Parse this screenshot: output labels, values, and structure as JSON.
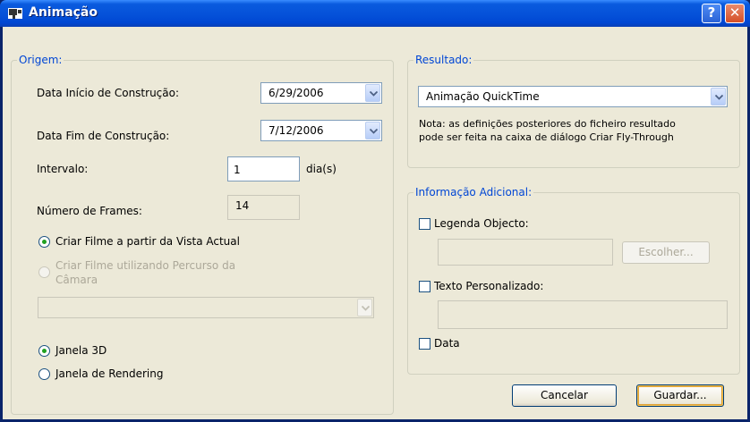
{
  "window": {
    "title": "Animação",
    "help_label": "?",
    "close_label": "✕"
  },
  "origem": {
    "legend": "Origem:",
    "data_inicio_label": "Data Início de Construção:",
    "data_inicio_value": "6/29/2006",
    "data_fim_label": "Data Fim de Construção:",
    "data_fim_value": "7/12/2006",
    "intervalo_label": "Intervalo:",
    "intervalo_value": "1",
    "intervalo_unit": "dia(s)",
    "num_frames_label": "Número de Frames:",
    "num_frames_value": "14",
    "radio_vista_actual": "Criar Filme a partir da Vista Actual",
    "radio_percurso_line1": "Criar Filme utilizando Percurso da",
    "radio_percurso_line2": "Câmara",
    "percurso_select_value": "",
    "radio_janela_3d": "Janela 3D",
    "radio_janela_rendering": "Janela de Rendering"
  },
  "resultado": {
    "legend": "Resultado:",
    "format_value": "Animação QuickTime",
    "note_line1": "Nota: as definições posteriores do ficheiro resultado",
    "note_line2": "pode ser feita na caixa de diálogo Criar Fly-Through"
  },
  "info": {
    "legend": "Informação Adicional:",
    "legenda_objecto_label": "Legenda Objecto:",
    "escolher_label": "Escolher...",
    "texto_personalizado_label": "Texto Personalizado:",
    "data_label": "Data"
  },
  "buttons": {
    "cancel_label": "Cancelar",
    "save_label": "Guardar..."
  },
  "colors": {
    "title_bar": "#0a5bde",
    "dialog_bg": "#ece9d8",
    "legend_text": "#0046d5",
    "radio_dot": "#21a121"
  }
}
